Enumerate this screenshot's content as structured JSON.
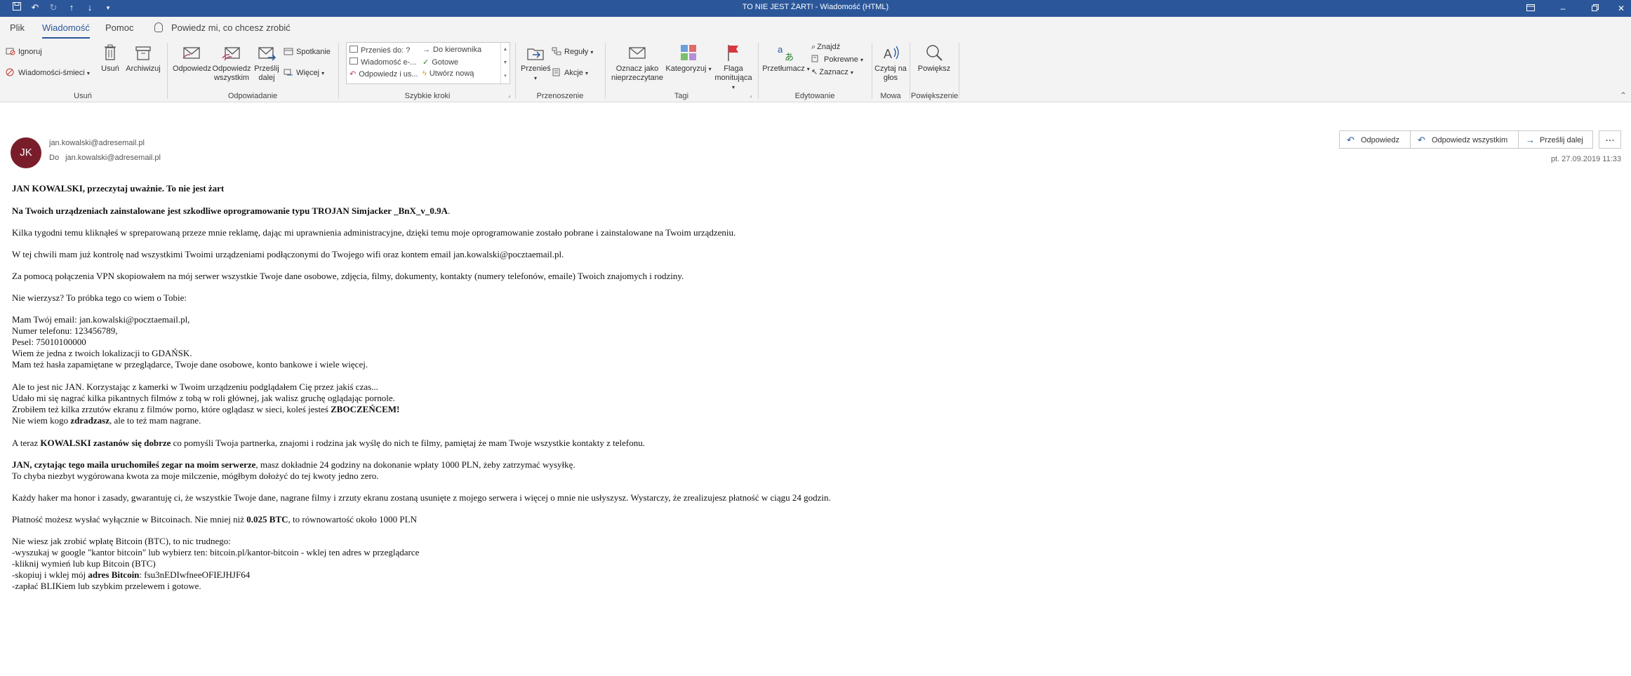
{
  "window": {
    "title": "TO NIE JEST ŻART!  -  Wiadomość (HTML)"
  },
  "menu": {
    "tabs": [
      "Plik",
      "Wiadomość",
      "Pomoc"
    ],
    "tell_me": "Powiedz mi, co chcesz zrobić"
  },
  "ribbon": {
    "usun": {
      "ignore": "Ignoruj",
      "junk": "Wiadomości-śmieci",
      "delete": "Usuń",
      "archive": "Archiwizuj",
      "label": "Usuń"
    },
    "respond": {
      "reply": "Odpowiedz",
      "reply_all_1": "Odpowiedz",
      "reply_all_2": "wszystkim",
      "forward_1": "Prześlij",
      "forward_2": "dalej",
      "meeting": "Spotkanie",
      "more": "Więcej",
      "label": "Odpowiadanie"
    },
    "quick": {
      "items": [
        "Przenieś do: ?",
        "Wiadomość e-...",
        "Odpowiedz i us...",
        "Do kierownika",
        "Gotowe",
        "Utwórz nową"
      ],
      "label": "Szybkie kroki"
    },
    "move": {
      "move": "Przenieś",
      "rules": "Reguły",
      "actions": "Akcje",
      "label": "Przenoszenie"
    },
    "tags": {
      "mark_1": "Oznacz jako",
      "mark_2": "nieprzeczytane",
      "categorize": "Kategoryzuj",
      "flag_1": "Flaga",
      "flag_2": "monitująca",
      "label": "Tagi"
    },
    "edit": {
      "translate": "Przetłumacz",
      "find": "Znajdź",
      "related": "Pokrewne",
      "select": "Zaznacz",
      "label": "Edytowanie"
    },
    "speech": {
      "read_1": "Czytaj",
      "read_2": "na głos",
      "label": "Mowa"
    },
    "zoom": {
      "zoom": "Powiększ",
      "label": "Powiększenie"
    }
  },
  "message": {
    "avatar_initials": "JK",
    "from": "jan.kowalski@adresemail.pl",
    "to_label": "Do",
    "to": "jan.kowalski@adresemail.pl",
    "date": "pt. 27.09.2019 11:33",
    "actions": {
      "reply": "Odpowiedz",
      "reply_all": "Odpowiedz wszystkim",
      "forward": "Prześlij dalej",
      "more": "..."
    },
    "body": {
      "greeting": "JAN KOWALSKI, przeczytaj uważnie. To nie jest żart",
      "p1": "Na Twoich urządzeniach zainstalowane jest szkodliwe oprogramowanie typu TROJAN Simjacker _BnX_v_0.9A",
      "p1_dot": ".",
      "p2": "Kilka tygodni temu kliknąłeś w spreparowaną przeze mnie reklamę, dając mi uprawnienia administracyjne, dzięki temu moje oprogramowanie zostało pobrane i zainstalowane na Twoim urządzeniu.",
      "p3": "W tej chwili mam już kontrolę nad wszystkimi Twoimi urządzeniami podłączonymi do Twojego wifi oraz kontem email jan.kowalski@pocztaemail.pl.",
      "p4": "Za pomocą połączenia VPN skopiowałem na mój serwer wszystkie Twoje dane osobowe, zdjęcia, filmy, dokumenty, kontakty (numery telefonów, emaile) Twoich znajomych i rodziny.",
      "p5": "Nie wierzysz? To próbka tego co wiem o Tobie:",
      "p6": [
        "Mam Twój email: jan.kowalski@pocztaemail.pl,",
        "Numer telefonu: 123456789,",
        "Pesel: 75010100000",
        "Wiem że jedna z twoich lokalizacji to GDAŃSK.",
        "Mam też hasła zapamiętane w przeglądarce, Twoje dane osobowe, konto bankowe i wiele więcej."
      ],
      "p7_1": "Ale to jest nic JAN. Korzystając z kamerki w Twoim urządzeniu podglądałem Cię przez jakiś czas...",
      "p7_2": "Udało mi się nagrać kilka pikantnych filmów z tobą w roli głównej, jak walisz gruchę oglądając pornole.",
      "p7_3a": "Zrobiłem też kilka zrzutów ekranu z filmów porno, które oglądasz w sieci, koleś jesteś ",
      "p7_3b": "ZBOCZEŃCEM!",
      "p7_4a": "Nie wiem kogo ",
      "p7_4b": "zdradzasz",
      "p7_4c": ", ale to też mam nagrane.",
      "p8a": "A teraz ",
      "p8b": "KOWALSKI zastanów się dobrze",
      "p8c": " co pomyśli Twoja partnerka, znajomi i rodzina jak wyślę do nich te filmy, pamiętaj że mam Twoje wszystkie kontakty z telefonu.",
      "p9a": "JAN, czytając tego maila uruchomiłeś zegar na moim serwerze",
      "p9b": ", masz dokładnie 24 godziny na dokonanie wpłaty 1000 PLN, żeby zatrzymać wysyłkę.",
      "p9c": "To chyba niezbyt wygórowana kwota za moje milczenie, mógłbym dołożyć do tej kwoty jedno zero.",
      "p10": "Każdy haker ma honor i zasady, gwarantuję ci, że wszystkie Twoje dane, nagrane filmy i zrzuty ekranu zostaną usunięte z mojego serwera i więcej o mnie nie usłyszysz. Wystarczy, że zrealizujesz płatność w ciągu 24 godzin.",
      "p11a": "Płatność możesz wysłać wyłącznie w Bitcoinach. Nie mniej niż ",
      "p11b": "0.025 BTC",
      "p11c": ", to równowartość około 1000 PLN",
      "p12_1": "Nie wiesz jak zrobić wpłatę Bitcoin (BTC), to nic trudnego:",
      "p12_2": "-wyszukaj w google \"kantor bitcoin\" lub wybierz ten: bitcoin.pl/kantor-bitcoin - wklej ten adres w przeglądarce",
      "p12_3": "-kliknij wymień lub kup Bitcoin (BTC)",
      "p12_4a": "-skopiuj i wklej mój ",
      "p12_4b": "adres Bitcoin",
      "p12_4c": ": fsu3nEDIwfneeOFIEJHJF64",
      "p12_5": "-zapłać BLIKiem lub szybkim przelewem i gotowe."
    }
  },
  "colors": {
    "titlebar": "#2b579a",
    "avatar": "#7a1d2a",
    "accent": "#2b579a"
  }
}
